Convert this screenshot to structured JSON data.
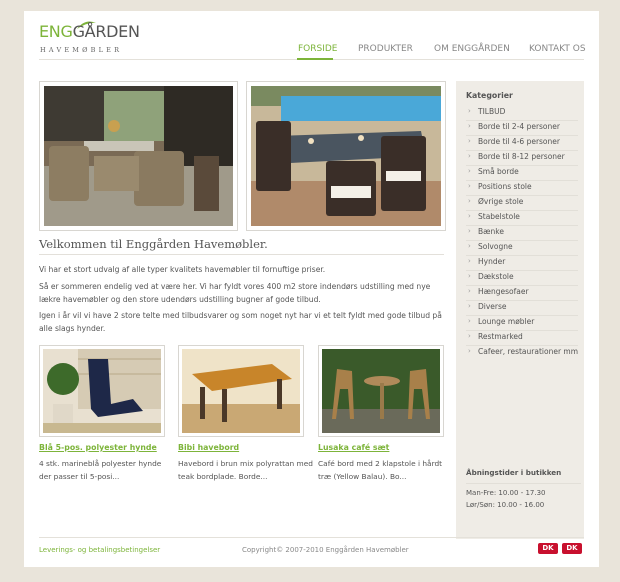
{
  "brand": {
    "logo_main_a": "ENG",
    "logo_main_b": "GÅRDEN",
    "logo_sub": "HAVEMØBLER"
  },
  "nav": {
    "items": [
      "FORSIDE",
      "PRODUKTER",
      "OM ENGGÅRDEN",
      "KONTAKT OS"
    ],
    "active": "FORSIDE"
  },
  "main": {
    "heading": "Velkommen til Enggården Havemøbler.",
    "paragraphs": [
      "Vi har et stort udvalg af alle typer kvalitets havemøbler til fornuftige priser.",
      "Så er sommeren endelig ved at være her. Vi har fyldt vores 400 m2 store indendørs udstilling med nye lækre havemøbler og den store udendørs udstilling bugner af gode tilbud.",
      "Igen i år vil vi have 2 store telte med tilbudsvarer og som noget nyt har vi et telt fyldt med gode tilbud på alle slags hynder."
    ],
    "products": [
      {
        "title": "Blå 5-pos. polyester hynde",
        "desc": "4 stk. marineblå polyester hynde der passer til 5-posi..."
      },
      {
        "title": "Bibi havebord",
        "desc": "Havebord i brun mix polyrattan med teak bordplade. Borde..."
      },
      {
        "title": "Lusaka café sæt",
        "desc": "Café bord med 2 klapstole i hårdt træ (Yellow Balau). Bo..."
      }
    ]
  },
  "sidebar": {
    "title": "Kategorier",
    "categories": [
      "TILBUD",
      "Borde til 2-4 personer",
      "Borde til 4-6 personer",
      "Borde til 8-12 personer",
      "Små borde",
      "Positions stole",
      "Øvrige stole",
      "Stabelstole",
      "Bænke",
      "Solvogne",
      "Hynder",
      "Dækstole",
      "Hængesofaer",
      "Diverse",
      "Lounge møbler",
      "Restmarked",
      "Cafeer, restaurationer mm"
    ],
    "hours_title": "Åbningstider i butikken",
    "hours": [
      "Man-Fre: 10.00 - 17.30",
      "Lør/Søn: 10.00 - 16.00"
    ]
  },
  "footer": {
    "link": "Leverings- og betalingsbetingelser",
    "copyright": "Copyright© 2007-2010 Enggården Havemøbler",
    "badge1": "DK",
    "badge2": "DK"
  },
  "colors": {
    "accent": "#7db43a",
    "page_bg": "#e9e4da",
    "sidebar_bg": "#efece6"
  }
}
